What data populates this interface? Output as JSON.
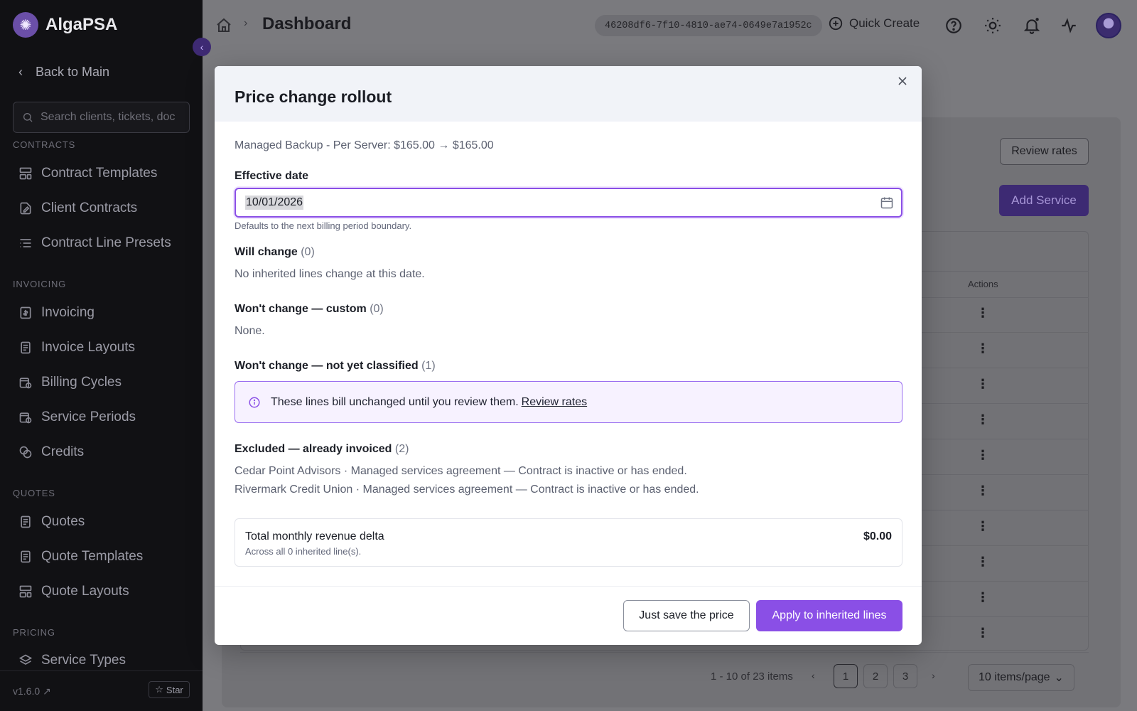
{
  "app": {
    "name": "AlgaPSA",
    "version": "v1.6.0",
    "star_label": "Star"
  },
  "sidebar": {
    "back_label": "Back to Main",
    "search_placeholder": "Search clients, tickets, doc",
    "sections": {
      "contracts": "CONTRACTS",
      "invoicing": "INVOICING",
      "quotes": "QUOTES",
      "pricing": "PRICING"
    },
    "items": {
      "contract_templates": "Contract Templates",
      "client_contracts": "Client Contracts",
      "contract_line_presets": "Contract Line Presets",
      "invoicing": "Invoicing",
      "invoice_layouts": "Invoice Layouts",
      "billing_cycles": "Billing Cycles",
      "service_periods": "Service Periods",
      "credits": "Credits",
      "quotes": "Quotes",
      "quote_templates": "Quote Templates",
      "quote_layouts": "Quote Layouts",
      "service_types": "Service Types"
    }
  },
  "header": {
    "title": "Dashboard",
    "tenant_id": "46208df6-7f10-4810-ae74-0649e7a1952c",
    "quick_create": "Quick Create"
  },
  "background": {
    "review_rates": "Review rates",
    "add_service": "Add Service",
    "actions_header": "Actions",
    "pager_text": "1 - 10 of 23 items",
    "pages": [
      "1",
      "2",
      "3"
    ],
    "per_page": "10 items/page"
  },
  "modal": {
    "title": "Price change rollout",
    "summary": "Managed Backup - Per Server: $165.00 → $165.00",
    "effective_date_label": "Effective date",
    "effective_date_value": "10/01/2026",
    "effective_date_hint": "Defaults to the next billing period boundary.",
    "will_change": {
      "title": "Will change",
      "count": "(0)",
      "text": "No inherited lines change at this date."
    },
    "wont_change_custom": {
      "title": "Won't change — custom",
      "count": "(0)",
      "text": "None."
    },
    "wont_change_unclassified": {
      "title": "Won't change — not yet classified",
      "count": "(1)",
      "notice": "These lines bill unchanged until you review them.",
      "notice_link": "Review rates"
    },
    "excluded": {
      "title": "Excluded — already invoiced",
      "count": "(2)",
      "lines": [
        "Cedar Point Advisors · Managed services agreement — Contract is inactive or has ended.",
        "Rivermark Credit Union · Managed services agreement — Contract is inactive or has ended."
      ]
    },
    "total": {
      "label": "Total monthly revenue delta",
      "sub": "Across all 0 inherited line(s).",
      "value": "$0.00"
    },
    "buttons": {
      "secondary": "Just save the price",
      "primary": "Apply to inherited lines"
    }
  },
  "colors": {
    "accent": "#8a4fe6",
    "sidebar_bg": "#111114",
    "overlay": "#7a7a7e"
  }
}
